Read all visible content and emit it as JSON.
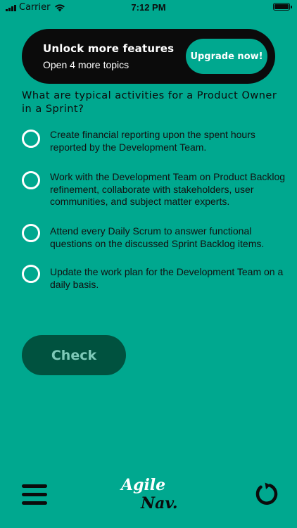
{
  "status_bar": {
    "carrier": "Carrier",
    "time": "7:12 PM"
  },
  "promo": {
    "title": "Unlock more features",
    "subtitle": "Open 4 more topics",
    "upgrade_label": "Upgrade now!"
  },
  "question": {
    "text": "What are typical activities for a Product Owner in a Sprint?",
    "answers": [
      {
        "text": "Create financial reporting upon the spent hours reported by the Development Team.",
        "selected": false
      },
      {
        "text": "Work with the Development Team on Product Backlog refinement, collaborate with stakeholders, user communities, and subject matter experts.",
        "selected": false
      },
      {
        "text": "Attend every Daily Scrum to answer functional questions on the discussed Sprint Backlog items.",
        "selected": false
      },
      {
        "text": "Update the work plan for the Development Team on a daily basis.",
        "selected": false
      }
    ]
  },
  "check_label": "Check",
  "logo": {
    "line1": "Agile",
    "line2": "Nav."
  },
  "icons": {
    "menu": "hamburger-menu-icon",
    "refresh": "refresh-icon",
    "wifi": "wifi-icon",
    "battery": "battery-icon"
  },
  "colors": {
    "background": "#00A88F",
    "banner": "#0B0B0B",
    "check_button": "#00523F",
    "check_text": "#7EC9B8",
    "radio": "#FFFFFF"
  }
}
